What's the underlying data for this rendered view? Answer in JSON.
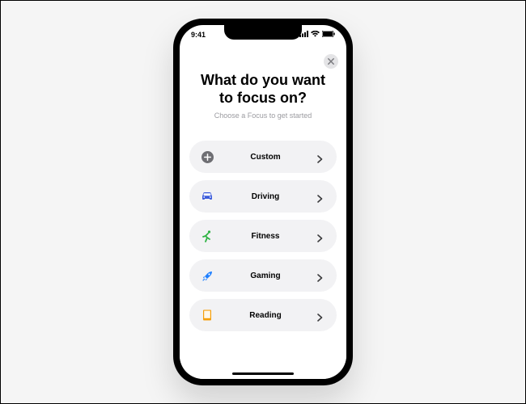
{
  "status": {
    "time": "9:41"
  },
  "sheet": {
    "title": "What do you want\nto focus on?",
    "subtitle": "Choose a Focus to get started"
  },
  "options": [
    {
      "label": "Custom",
      "icon": "plus",
      "color": "#6e6e73"
    },
    {
      "label": "Driving",
      "icon": "car",
      "color": "#3b5bdb"
    },
    {
      "label": "Fitness",
      "icon": "runner",
      "color": "#2fb344"
    },
    {
      "label": "Gaming",
      "icon": "rocket",
      "color": "#1e7fff"
    },
    {
      "label": "Reading",
      "icon": "book",
      "color": "#f59f0a"
    }
  ]
}
